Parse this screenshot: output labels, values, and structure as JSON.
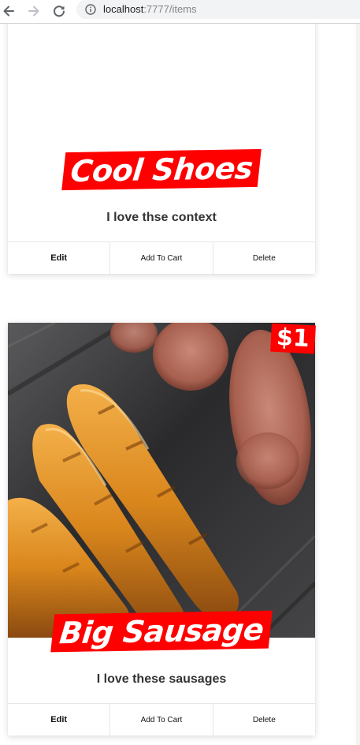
{
  "browser": {
    "url_host": "localhost",
    "url_path": ":7777/items",
    "icons": {
      "back": "arrow-left-icon",
      "forward": "arrow-right-icon",
      "reload": "reload-icon",
      "info": "info-circle-icon"
    }
  },
  "items": [
    {
      "title": "Cool Shoes",
      "description": "I love thse context",
      "buttons": {
        "edit": "Edit",
        "add_to_cart": "Add To Cart",
        "delete": "Delete"
      }
    },
    {
      "title": "Big Sausage",
      "price": "$1",
      "description": "I love these sausages",
      "buttons": {
        "edit": "Edit",
        "add_to_cart": "Add To Cart",
        "delete": "Delete"
      }
    }
  ],
  "colors": {
    "accent_red": "#ff0000",
    "text_dark": "#333333"
  }
}
